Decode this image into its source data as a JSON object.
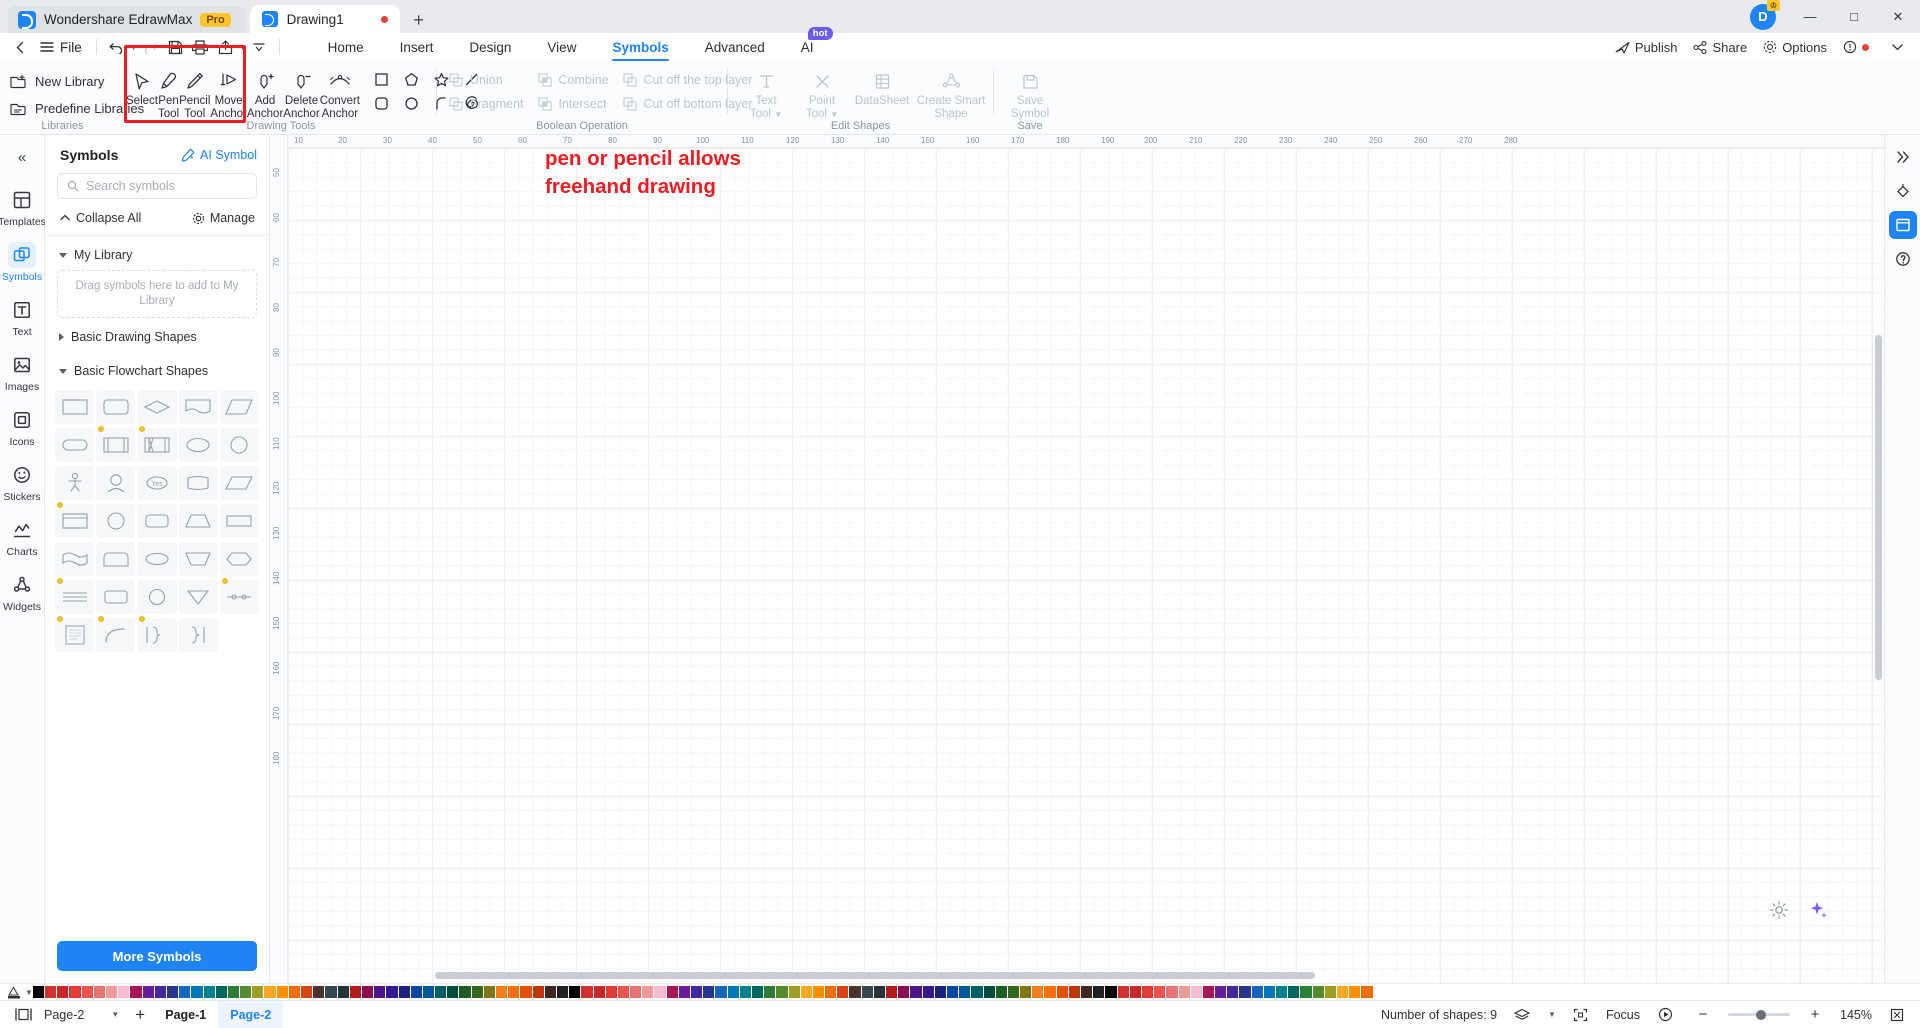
{
  "titlebar": {
    "app_name": "Wondershare EdrawMax",
    "pro_badge": "Pro",
    "document_tab": "Drawing1",
    "new_tab_label": "+",
    "avatar_initial": "D",
    "minimize": "—",
    "maximize": "□",
    "close": "✕"
  },
  "menubar": {
    "file_label": "File",
    "tabs": [
      {
        "label": "Home",
        "active": false
      },
      {
        "label": "Insert",
        "active": false
      },
      {
        "label": "Design",
        "active": false
      },
      {
        "label": "View",
        "active": false
      },
      {
        "label": "Symbols",
        "active": true
      },
      {
        "label": "Advanced",
        "active": false
      },
      {
        "label": "AI",
        "active": false,
        "badge": "hot"
      }
    ],
    "right_items": [
      {
        "label": "Publish",
        "icon": "publish-icon"
      },
      {
        "label": "Share",
        "icon": "share-icon"
      },
      {
        "label": "Options",
        "icon": "options-icon"
      }
    ]
  },
  "ribbon": {
    "groups": [
      {
        "title": "Libraries",
        "commands": [
          {
            "label": "New Library",
            "icon": "new-library-icon"
          },
          {
            "label": "Predefine Libraries",
            "icon": "predefine-libraries-icon"
          }
        ]
      },
      {
        "title": "Drawing Tools",
        "tools": [
          {
            "label_line1": "Select",
            "label_line2": "",
            "icon": "cursor-arrow-icon",
            "disabled": false
          },
          {
            "label_line1": "Pen",
            "label_line2": "Tool",
            "icon": "pen-icon",
            "disabled": false
          },
          {
            "label_line1": "Pencil",
            "label_line2": "Tool",
            "icon": "pencil-icon",
            "disabled": false
          },
          {
            "label_line1": "Move",
            "label_line2": "Anchor",
            "icon": "move-anchor-icon",
            "disabled": false
          },
          {
            "label_line1": "Add",
            "label_line2": "Anchor",
            "icon": "add-anchor-icon",
            "disabled": false
          },
          {
            "label_line1": "Delete",
            "label_line2": "Anchor",
            "icon": "delete-anchor-icon",
            "disabled": false
          },
          {
            "label_line1": "Convert",
            "label_line2": "Anchor",
            "icon": "convert-anchor-icon",
            "disabled": false
          }
        ],
        "shapes": [
          "square-icon",
          "pentagon-icon",
          "star-icon",
          "line-icon",
          "rounded-square-icon",
          "circle-icon",
          "arc-icon",
          "spiral-icon"
        ]
      },
      {
        "title": "Boolean Operation",
        "items": [
          {
            "label": "Union",
            "disabled": true
          },
          {
            "label": "Combine",
            "disabled": true
          },
          {
            "label": "Cut off the top layer",
            "disabled": true
          },
          {
            "label": "Fragment",
            "disabled": true
          },
          {
            "label": "Intersect",
            "disabled": true
          },
          {
            "label": "Cut off bottom layer",
            "disabled": true
          }
        ]
      },
      {
        "title": "Edit Shapes",
        "tools": [
          {
            "label_line1": "Text",
            "label_line2": "Tool",
            "icon": "text-tool-icon",
            "disabled": true,
            "dropdown": true
          },
          {
            "label_line1": "Point",
            "label_line2": "Tool",
            "icon": "point-tool-icon",
            "disabled": true,
            "dropdown": true
          },
          {
            "label_line1": "DataSheet",
            "label_line2": "",
            "icon": "datasheet-icon",
            "disabled": true
          },
          {
            "label_line1": "Create Smart",
            "label_line2": "Shape",
            "icon": "smart-shape-icon",
            "disabled": true
          }
        ]
      },
      {
        "title": "Save",
        "tools": [
          {
            "label_line1": "Save",
            "label_line2": "Symbol",
            "icon": "save-symbol-icon",
            "disabled": true
          }
        ]
      }
    ]
  },
  "left_rail": {
    "items": [
      {
        "label": "Templates",
        "icon": "templates-icon",
        "active": false
      },
      {
        "label": "Symbols",
        "icon": "symbols-icon",
        "active": true
      },
      {
        "label": "Text",
        "icon": "text-icon",
        "active": false
      },
      {
        "label": "Images",
        "icon": "images-icon",
        "active": false
      },
      {
        "label": "Icons",
        "icon": "icons-icon",
        "active": false
      },
      {
        "label": "Stickers",
        "icon": "stickers-icon",
        "active": false
      },
      {
        "label": "Charts",
        "icon": "charts-icon",
        "active": false
      },
      {
        "label": "Widgets",
        "icon": "widgets-icon",
        "active": false
      }
    ]
  },
  "panel": {
    "title": "Symbols",
    "ai_symbol_label": "AI Symbol",
    "search_placeholder": "Search symbols",
    "collapse_all_label": "Collapse All",
    "manage_label": "Manage",
    "groups": [
      {
        "label": "My Library",
        "expanded": true,
        "empty_text": "Drag symbols here to add to My Library"
      },
      {
        "label": "Basic Drawing Shapes",
        "expanded": false
      },
      {
        "label": "Basic Flowchart Shapes",
        "expanded": true
      }
    ],
    "more_symbols_label": "More Symbols",
    "flowchart_shapes": [
      {
        "name": "process-rect",
        "pin": false
      },
      {
        "name": "rounded-process",
        "pin": false
      },
      {
        "name": "decision-diamond",
        "pin": false
      },
      {
        "name": "document-wave",
        "pin": false
      },
      {
        "name": "parallelogram-data",
        "pin": false
      },
      {
        "name": "terminator-stadium",
        "pin": false
      },
      {
        "name": "predefined-process",
        "pin": true
      },
      {
        "name": "internal-storage",
        "pin": true
      },
      {
        "name": "ellipse-connector",
        "pin": false
      },
      {
        "name": "circle-connector",
        "pin": false
      },
      {
        "name": "manual-operation-person",
        "pin": false
      },
      {
        "name": "user-head",
        "pin": false
      },
      {
        "name": "yes-badge",
        "pin": false
      },
      {
        "name": "stored-data",
        "pin": false
      },
      {
        "name": "parallelogram-2",
        "pin": false
      },
      {
        "name": "card-rect",
        "pin": true
      },
      {
        "name": "circle-plain",
        "pin": false
      },
      {
        "name": "rounded-wide",
        "pin": false
      },
      {
        "name": "trapezoid",
        "pin": false
      },
      {
        "name": "flat-rect",
        "pin": false
      },
      {
        "name": "wave-document",
        "pin": false
      },
      {
        "name": "rounded-tab",
        "pin": false
      },
      {
        "name": "ellipse-flat",
        "pin": false
      },
      {
        "name": "trapezoid-down",
        "pin": false
      },
      {
        "name": "hexagon-flat",
        "pin": false
      },
      {
        "name": "lines-stack",
        "pin": true
      },
      {
        "name": "offpage-connector",
        "pin": false
      },
      {
        "name": "circle-outline",
        "pin": false
      },
      {
        "name": "triangle-down",
        "pin": false
      },
      {
        "name": "junction-line",
        "pin": true
      },
      {
        "name": "note-text",
        "pin": true
      },
      {
        "name": "arc-curve",
        "pin": true
      },
      {
        "name": "brace-left",
        "pin": true
      },
      {
        "name": "brace-right",
        "pin": false
      }
    ]
  },
  "canvas": {
    "annotation_line1": "pen or pencil allows",
    "annotation_line2": "freehand drawing",
    "annotation_color": "#ef1d22",
    "ruler_h_ticks": [
      "10",
      "20",
      "30",
      "40",
      "50",
      "60",
      "70",
      "80",
      "90",
      "100",
      "110",
      "120",
      "130",
      "140",
      "150",
      "160",
      "170",
      "180",
      "190",
      "200",
      "210",
      "220",
      "230",
      "240",
      "250",
      "260",
      "270",
      "280"
    ],
    "ruler_v_ticks": [
      "50",
      "60",
      "70",
      "80",
      "90",
      "100",
      "110",
      "120",
      "130",
      "140",
      "150",
      "160",
      "170",
      "180"
    ]
  },
  "right_rail": {
    "items": [
      {
        "icon": "collapse-right-icon",
        "active": false
      },
      {
        "icon": "fill-format-icon",
        "active": false
      },
      {
        "icon": "page-layout-icon",
        "active": true
      },
      {
        "icon": "help-icon",
        "active": false
      }
    ]
  },
  "statusbar": {
    "page_selector": "Page-2",
    "add_page_label": "+",
    "page_tabs": [
      {
        "label": "Page-1",
        "active": false
      },
      {
        "label": "Page-2",
        "active": true
      }
    ],
    "shape_count_label": "Number of shapes: 9",
    "focus_label": "Focus",
    "zoom_level": "145%",
    "zoom_out": "−",
    "zoom_in": "+"
  },
  "colors": {
    "accent": "#1f84f5",
    "annotation_red": "#ef1d22",
    "pro_yellow": "#ffc52b",
    "hot_purple": "#6b5bf5",
    "swatches": [
      "#000000",
      "#d32f2f",
      "#c62828",
      "#e53935",
      "#ef5350",
      "#e57373",
      "#ef9a9a",
      "#f8bbd0",
      "#ad1457",
      "#6a1b9a",
      "#4527a0",
      "#283593",
      "#1565c0",
      "#0277bd",
      "#00838f",
      "#00695c",
      "#2e7d32",
      "#558b2f",
      "#9e9d24",
      "#f9a825",
      "#ff8f00",
      "#ef6c00",
      "#d84315",
      "#4e342e",
      "#37474f",
      "#263238",
      "#b71c1c",
      "#880e4f",
      "#4a148c",
      "#311b92",
      "#1a237e",
      "#0d47a1",
      "#01579b",
      "#006064",
      "#004d40",
      "#1b5e20",
      "#33691e",
      "#827717",
      "#f57f17",
      "#ff6f00",
      "#e65100",
      "#bf360c",
      "#3e2723",
      "#212121"
    ]
  }
}
